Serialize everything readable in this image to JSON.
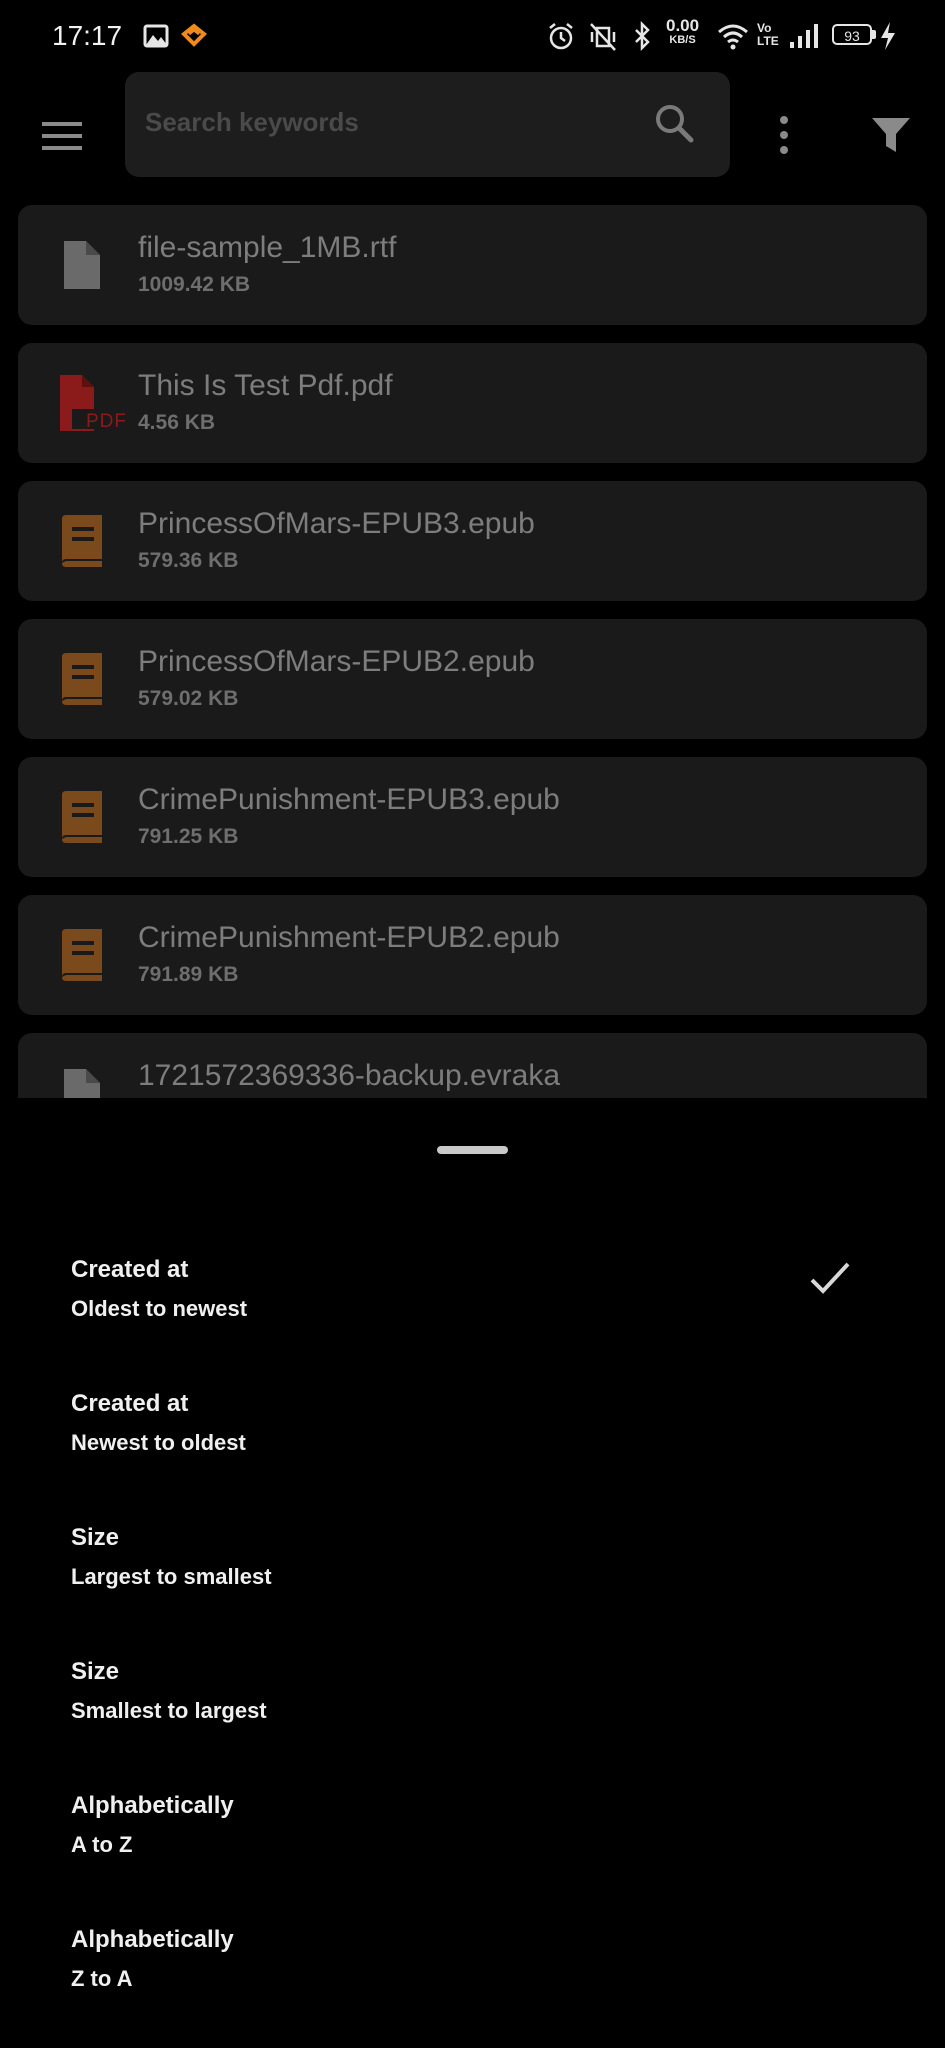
{
  "status_bar": {
    "time": "17:17",
    "net_speed_value": "0.00",
    "net_speed_unit": "KB/S",
    "volte_top": "Vo",
    "volte_bottom": "LTE",
    "battery": "93"
  },
  "header": {
    "search_placeholder": "Search keywords"
  },
  "files": [
    {
      "name": "file-sample_1MB.rtf",
      "size": "1009.42 KB",
      "icon": "document-icon"
    },
    {
      "name": "This Is Test Pdf.pdf",
      "size": "4.56 KB",
      "icon": "pdf-icon"
    },
    {
      "name": "PrincessOfMars-EPUB3.epub",
      "size": "579.36 KB",
      "icon": "book-icon"
    },
    {
      "name": "PrincessOfMars-EPUB2.epub",
      "size": "579.02 KB",
      "icon": "book-icon"
    },
    {
      "name": "CrimePunishment-EPUB3.epub",
      "size": "791.25 KB",
      "icon": "book-icon"
    },
    {
      "name": "CrimePunishment-EPUB2.epub",
      "size": "791.89 KB",
      "icon": "book-icon"
    },
    {
      "name": "1721572369336-backup.evraka",
      "size": "",
      "icon": "document-icon"
    }
  ],
  "pdf_badge": "PDF",
  "sort_options": [
    {
      "title": "Created at",
      "subtitle": "Oldest to newest",
      "selected": true
    },
    {
      "title": "Created at",
      "subtitle": "Newest to oldest",
      "selected": false
    },
    {
      "title": "Size",
      "subtitle": "Largest to smallest",
      "selected": false
    },
    {
      "title": "Size",
      "subtitle": "Smallest to largest",
      "selected": false
    },
    {
      "title": "Alphabetically",
      "subtitle": "A to Z",
      "selected": false
    },
    {
      "title": "Alphabetically",
      "subtitle": "Z to A",
      "selected": false
    }
  ],
  "colors": {
    "background": "#000000",
    "card": "#1a1a1a",
    "book_icon": "#7a4a1c",
    "pdf_icon": "#8b1a1a"
  }
}
